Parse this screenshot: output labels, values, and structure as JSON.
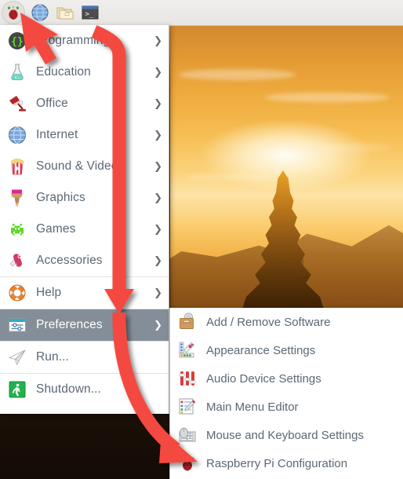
{
  "taskbar": {
    "items": [
      {
        "name": "raspberry-menu-button",
        "icon": "raspberry-icon",
        "label": "Menu"
      },
      {
        "name": "web-browser-button",
        "icon": "globe-icon",
        "label": "Web Browser"
      },
      {
        "name": "file-manager-button",
        "icon": "folder-icon",
        "label": "File Manager"
      },
      {
        "name": "terminal-button",
        "icon": "terminal-icon",
        "label": "Terminal"
      }
    ]
  },
  "menu": {
    "items": [
      {
        "label": "Programming",
        "icon": "braces-icon",
        "submenu": true,
        "selected": false,
        "separator_after": false
      },
      {
        "label": "Education",
        "icon": "flask-icon",
        "submenu": true,
        "selected": false,
        "separator_after": false
      },
      {
        "label": "Office",
        "icon": "desk-lamp-icon",
        "submenu": true,
        "selected": false,
        "separator_after": false
      },
      {
        "label": "Internet",
        "icon": "globe-icon",
        "submenu": true,
        "selected": false,
        "separator_after": false
      },
      {
        "label": "Sound & Video",
        "icon": "popcorn-icon",
        "submenu": true,
        "selected": false,
        "separator_after": false
      },
      {
        "label": "Graphics",
        "icon": "paintbrush-icon",
        "submenu": true,
        "selected": false,
        "separator_after": false
      },
      {
        "label": "Games",
        "icon": "space-invader-icon",
        "submenu": true,
        "selected": false,
        "separator_after": false
      },
      {
        "label": "Accessories",
        "icon": "pocket-knife-icon",
        "submenu": true,
        "selected": false,
        "separator_after": true
      },
      {
        "label": "Help",
        "icon": "life-ring-icon",
        "submenu": true,
        "selected": false,
        "separator_after": true
      },
      {
        "label": "Preferences",
        "icon": "sliders-panel-icon",
        "submenu": true,
        "selected": true,
        "separator_after": true
      },
      {
        "label": "Run...",
        "icon": "paper-plane-icon",
        "submenu": false,
        "selected": false,
        "separator_after": true
      },
      {
        "label": "Shutdown...",
        "icon": "exit-running-man-icon",
        "submenu": false,
        "selected": false,
        "separator_after": false
      }
    ]
  },
  "submenu": {
    "parent": "Preferences",
    "items": [
      {
        "label": "Add / Remove Software",
        "icon": "briefcase-disc-icon"
      },
      {
        "label": "Appearance Settings",
        "icon": "color-palette-icon"
      },
      {
        "label": "Audio Device Settings",
        "icon": "audio-sliders-icon"
      },
      {
        "label": "Main Menu Editor",
        "icon": "list-pencil-icon"
      },
      {
        "label": "Mouse and Keyboard Settings",
        "icon": "mouse-keyboard-icon"
      },
      {
        "label": "Raspberry Pi Configuration",
        "icon": "raspberry-icon"
      }
    ]
  },
  "annotation": {
    "type": "arrow",
    "color": "#f4483f",
    "from": "raspberry-menu-button",
    "to": "Raspberry Pi Configuration"
  },
  "colors": {
    "menu_background": "#ffffff",
    "menu_text": "#5b6876",
    "selection_background": "#848e98",
    "selection_text": "#ffffff",
    "taskbar_background": "#ebeae7",
    "annotation_red": "#f4483f"
  }
}
